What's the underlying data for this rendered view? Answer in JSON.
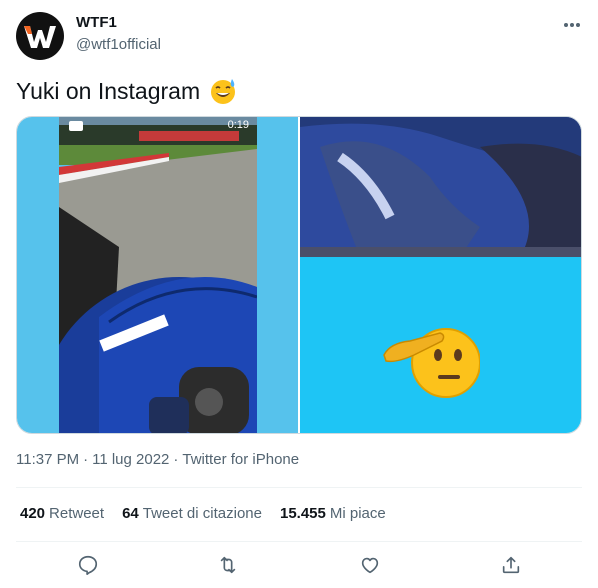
{
  "author": {
    "name": "WTF1",
    "handle": "@wtf1official",
    "avatar_icon": "wtf1-logo-icon"
  },
  "tweet": {
    "text": "Yuki on Instagram",
    "emoji": "grinning-face-with-sweat-icon"
  },
  "media": {
    "left_video_timer": "0:19",
    "left_bg_color": "#56c2ec",
    "right_bg_color": "#1ec5f5",
    "right_emoji": "saluting-face-icon"
  },
  "meta": {
    "time": "11:37 PM",
    "separator": "·",
    "date": "11 lug 2022",
    "source": "Twitter for iPhone"
  },
  "stats": {
    "retweets_count": "420",
    "retweets_label": "Retweet",
    "quotes_count": "64",
    "quotes_label": "Tweet di citazione",
    "likes_count": "15.455",
    "likes_label": "Mi piace"
  },
  "actions": [
    "reply-icon",
    "retweet-icon",
    "like-icon",
    "share-icon"
  ],
  "colors": {
    "text_primary": "#0f1419",
    "text_secondary": "#536471",
    "divider": "#eff3f4"
  }
}
